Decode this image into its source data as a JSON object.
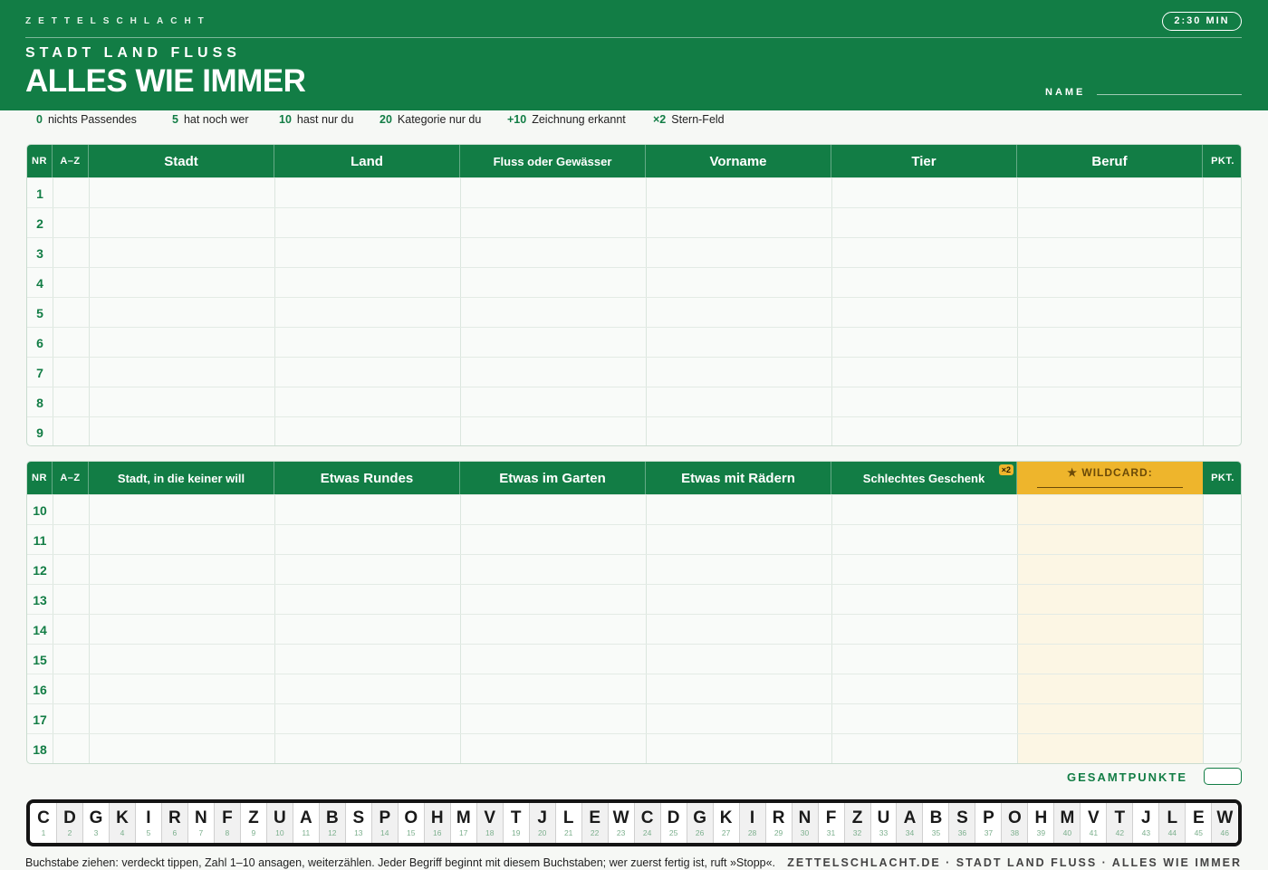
{
  "header": {
    "brand": "ZETTELSCHLACHT",
    "timer": "2:30 MIN",
    "subtitle": "STADT LAND FLUSS",
    "title": "ALLES WIE IMMER",
    "name_label": "NAME"
  },
  "scoring": [
    {
      "points": "0",
      "label": "nichts Passendes"
    },
    {
      "points": "5",
      "label": "hat noch wer"
    },
    {
      "points": "10",
      "label": "hast nur du"
    },
    {
      "points": "20",
      "label": "Kategorie nur du"
    },
    {
      "points": "+10",
      "label": "Zeichnung erkannt"
    },
    {
      "points": "×2",
      "label": "Stern-Feld"
    }
  ],
  "grid1": {
    "nr": "NR",
    "az": "A–Z",
    "columns": [
      "Stadt",
      "Land",
      "Fluss oder Gewässer",
      "Vorname",
      "Tier",
      "Beruf"
    ],
    "pkt": "PKT.",
    "rows": [
      "1",
      "2",
      "3",
      "4",
      "5",
      "6",
      "7",
      "8",
      "9"
    ]
  },
  "grid2": {
    "nr": "NR",
    "az": "A–Z",
    "columns": [
      "Stadt, in die keiner will",
      "Etwas Rundes",
      "Etwas im Garten",
      "Etwas mit Rädern",
      "Schlechtes Geschenk"
    ],
    "badge": "×2",
    "wildcard": "★ WILDCARD:",
    "pkt": "PKT.",
    "rows": [
      "10",
      "11",
      "12",
      "13",
      "14",
      "15",
      "16",
      "17",
      "18"
    ]
  },
  "total_label": "GESAMTPUNKTE",
  "letters": [
    "C",
    "D",
    "G",
    "K",
    "I",
    "R",
    "N",
    "F",
    "Z",
    "U",
    "A",
    "B",
    "S",
    "P",
    "O",
    "H",
    "M",
    "V",
    "T",
    "J",
    "L",
    "E",
    "W",
    "C",
    "D",
    "G",
    "K",
    "I",
    "R",
    "N",
    "F",
    "Z",
    "U",
    "A",
    "B",
    "S",
    "P",
    "O",
    "H",
    "M",
    "V",
    "T",
    "J",
    "L",
    "E",
    "W"
  ],
  "footer": {
    "left": "Buchstabe ziehen: verdeckt tippen, Zahl 1–10 ansagen, weiterzählen. Jeder Begriff beginnt mit diesem Buchstaben; wer zuerst fertig ist, ruft »Stopp«.",
    "right": "ZETTELSCHLACHT.DE · STADT LAND FLUSS · ALLES WIE IMMER"
  },
  "colors": {
    "brand_green": "#127d45",
    "wildcard_yellow": "#eeb52c",
    "wildcard_bg": "#fcf6e4"
  }
}
